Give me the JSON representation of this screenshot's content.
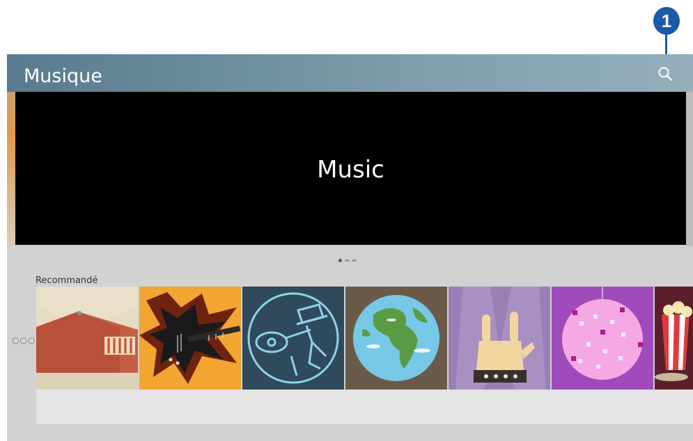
{
  "callout": {
    "number": "1"
  },
  "header": {
    "title": "Musique",
    "search_icon": "search-icon"
  },
  "hero": {
    "text": "Music",
    "page_dots": 3,
    "active_dot": 0
  },
  "recommended": {
    "label": "Recommandé",
    "more_icon": "more-dots-icon",
    "tiles": [
      {
        "icon": "barn-icon"
      },
      {
        "icon": "electric-guitar-icon"
      },
      {
        "icon": "acoustic-guitar-man-icon"
      },
      {
        "icon": "globe-icon"
      },
      {
        "icon": "rock-hand-icon"
      },
      {
        "icon": "disco-ball-icon"
      },
      {
        "icon": "popcorn-icon"
      }
    ]
  },
  "colors": {
    "header_left": "#587a8c",
    "header_right": "#94afbb",
    "callout": "#1a5aa6",
    "screen_bg": "#d2d2d2",
    "hero_bg": "#000000"
  }
}
